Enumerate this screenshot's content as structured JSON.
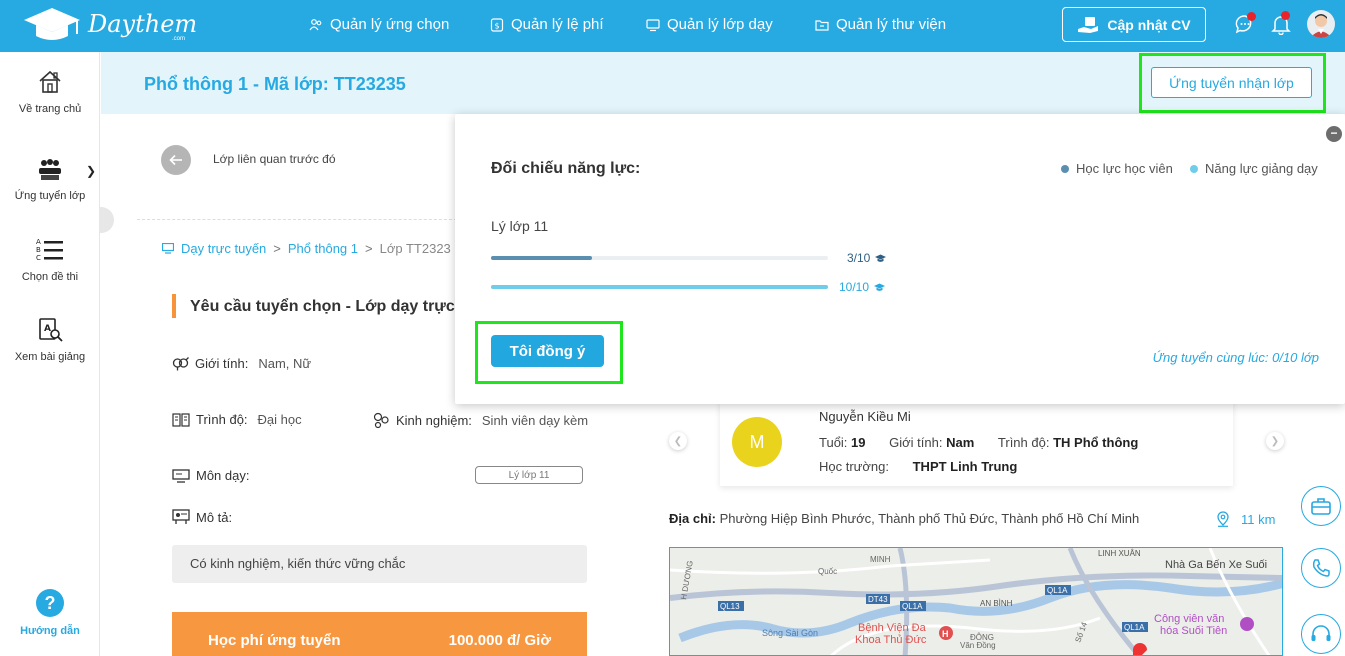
{
  "brand": {
    "name": "Daythem",
    "domain": ".com"
  },
  "nav": {
    "items": [
      {
        "label": "Quản lý ứng chọn",
        "icon": "users-icon"
      },
      {
        "label": "Quản lý lệ phí",
        "icon": "fee-icon"
      },
      {
        "label": "Quản lý lớp dạy",
        "icon": "monitor-icon"
      },
      {
        "label": "Quản lý thư viện",
        "icon": "folder-icon"
      }
    ],
    "cv_button": "Cập nhật CV"
  },
  "sidebar": {
    "items": [
      {
        "label": "Về trang chủ",
        "icon": "home-icon"
      },
      {
        "label": "Ứng tuyển lớp",
        "icon": "classroom-icon"
      },
      {
        "label": "Chọn đề thi",
        "icon": "exam-list-icon"
      },
      {
        "label": "Xem bài giảng",
        "icon": "lecture-search-icon"
      }
    ],
    "help": {
      "symbol": "?",
      "label": "Hướng dẫn"
    }
  },
  "header": {
    "title": "Phổ thông 1 - Mã lớp: TT23235",
    "apply_button": "Ứng tuyển nhận lớp"
  },
  "back": {
    "label": "Lớp liên quan trước đó"
  },
  "breadcrumb": {
    "items": [
      "Dạy trực tuyến",
      "Phổ thông 1",
      "Lớp TT2323"
    ],
    "separator": ">"
  },
  "requirements": {
    "title": "Yêu cầu tuyển chọn - Lớp dạy trực",
    "gender": {
      "label": "Giới tính:",
      "value": "Nam, Nữ"
    },
    "level": {
      "label": "Trình độ:",
      "value": "Đại học"
    },
    "experience": {
      "label": "Kinh nghiệm:",
      "value": "Sinh viên dạy kèm"
    },
    "subject": {
      "label": "Môn dạy:",
      "tag": "Lý lớp 11"
    },
    "description": {
      "label": "Mô tả:",
      "value": "Có kinh nghiệm, kiến thức vững chắc"
    },
    "fee": {
      "label": "Học phí ứng tuyển",
      "value": "100.000 đ/ Giờ"
    }
  },
  "popup": {
    "title": "Đối chiếu năng lực:",
    "legend": [
      {
        "label": "Học lực học viên",
        "color": "#5b8fb0"
      },
      {
        "label": "Năng lực giảng dạy",
        "color": "#6fcde9"
      }
    ],
    "subject": "Lý lớp 11",
    "bars": [
      {
        "score_text": "3/10",
        "value": 3,
        "max": 10,
        "color": "#5b8fb0",
        "text_color": "#2f5f85"
      },
      {
        "score_text": "10/10",
        "value": 10,
        "max": 10,
        "color": "#6fcde9",
        "text_color": "#27a9e1"
      }
    ],
    "agree_button": "Tôi đồng ý",
    "note": "Ứng tuyển cùng lúc: 0/10 lớp",
    "close": "−"
  },
  "student": {
    "initial": "M",
    "name": "Nguyễn Kiều Mi",
    "age_label": "Tuổi:",
    "age": "19",
    "gender_label": "Giới tính:",
    "gender": "Nam",
    "level_label": "Trình độ:",
    "level": "TH Phổ thông",
    "school_label": "Học trường:",
    "school": "THPT Linh Trung"
  },
  "address": {
    "label": "Địa chỉ:",
    "value": "Phường Hiệp Bình Phước, Thành phố Thủ Đức, Thành phố Hồ Chí Minh",
    "distance": "11 km"
  },
  "map": {
    "labels": [
      "Nhà Ga Bến Xe Suối",
      "LINH XUÂN",
      "Công viên văn",
      "hóa Suối Tiên",
      "Bệnh Viện Đa",
      "Khoa Thủ Đức",
      "AN BÌNH",
      "Sông Sài Gòn",
      "QL13",
      "QL1A",
      "QL1A",
      "QL1A",
      "DT43",
      "Quốc",
      "MINH",
      "H DƯƠNG",
      "ĐÔNG",
      "Văn Đồng",
      "Số 14"
    ]
  },
  "colors": {
    "primary": "#27a9e1",
    "accent": "#f79841",
    "highlight": "#1fe51c"
  }
}
